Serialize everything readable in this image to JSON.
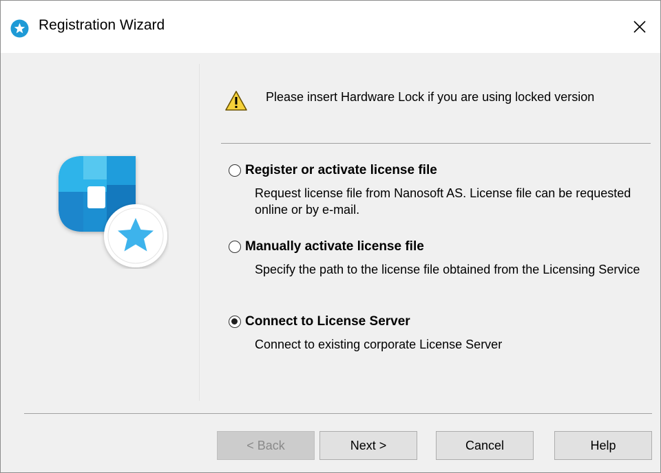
{
  "window": {
    "title": "Registration Wizard",
    "close_glyph": "✕",
    "icon": "registration-star-icon",
    "accent_color": "#1e9ad6"
  },
  "warning": {
    "icon": "warning-triangle-icon",
    "text": "Please insert Hardware Lock if you are using locked version"
  },
  "options": [
    {
      "label": "Register or activate license file",
      "description": "Request license file from Nanosoft AS. License file can be requested online or by e-mail.",
      "selected": false
    },
    {
      "label": "Manually activate license file",
      "description": "Specify the path to the license file obtained from the Licensing Service",
      "selected": false
    },
    {
      "label": "Connect to License Server",
      "description": "Connect to existing corporate License Server",
      "selected": true
    }
  ],
  "buttons": {
    "back": "< Back",
    "next": "Next >",
    "cancel": "Cancel",
    "help": "Help"
  }
}
